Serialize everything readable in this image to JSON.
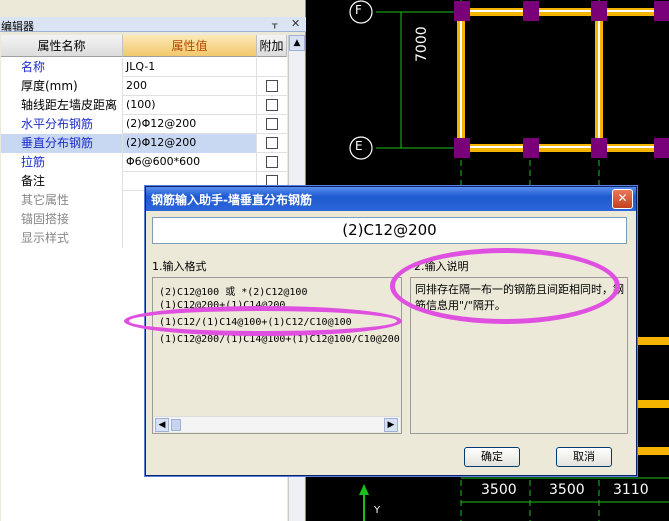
{
  "cad": {
    "axes": [
      {
        "label": "F",
        "kind": "row"
      },
      {
        "label": "E",
        "kind": "row"
      }
    ],
    "dimensions": [
      "7000",
      "3500",
      "3500",
      "3110"
    ],
    "ucs_label": "Y"
  },
  "editor": {
    "title": "编辑器",
    "columns": {
      "name": "属性名称",
      "value": "属性值",
      "add": "附加"
    },
    "rows": [
      {
        "name": "名称",
        "value": "JLQ-1",
        "blue": true,
        "checkbox": false
      },
      {
        "name": "厚度(mm)",
        "value": "200",
        "blue": false,
        "checkbox": true
      },
      {
        "name": "轴线距左墙皮距离",
        "value": "(100)",
        "blue": false,
        "checkbox": true
      },
      {
        "name": "水平分布钢筋",
        "value": "(2)Φ12@200",
        "blue": true,
        "checkbox": true
      },
      {
        "name": "垂直分布钢筋",
        "value": "(2)Φ12@200",
        "blue": true,
        "checkbox": true,
        "selected": true
      },
      {
        "name": "拉筋",
        "value": "Φ6@600*600",
        "blue": true,
        "checkbox": true
      },
      {
        "name": "备注",
        "value": "",
        "blue": false,
        "checkbox": true
      }
    ],
    "groups": [
      "其它属性",
      "锚固搭接",
      "显示样式"
    ]
  },
  "dialog": {
    "title": "钢筋输入助手-墙垂直分布钢筋",
    "result": "(2)C12@200",
    "format_label": "1.输入格式",
    "explain_label": "2.输入说明",
    "formats": [
      "(2)C12@100 或 *(2)C12@100",
      "(1)C12@200+(1)C14@200",
      "(1)C12/(1)C14@100+(1)C12/C10@100",
      "(1)C12@200/(1)C14@100+(1)C12@100/C10@200"
    ],
    "explanation": "同排存在隔一布一的钢筋且间距相同时，钢筋信息用\"/\"隔开。",
    "ok_label": "确定",
    "cancel_label": "取消"
  },
  "colors": {
    "wall": "#f5b400",
    "column": "#7a007a",
    "grid": "#ffffff",
    "axis_line": "#1bbf1b",
    "annotation": "#e050e0"
  }
}
